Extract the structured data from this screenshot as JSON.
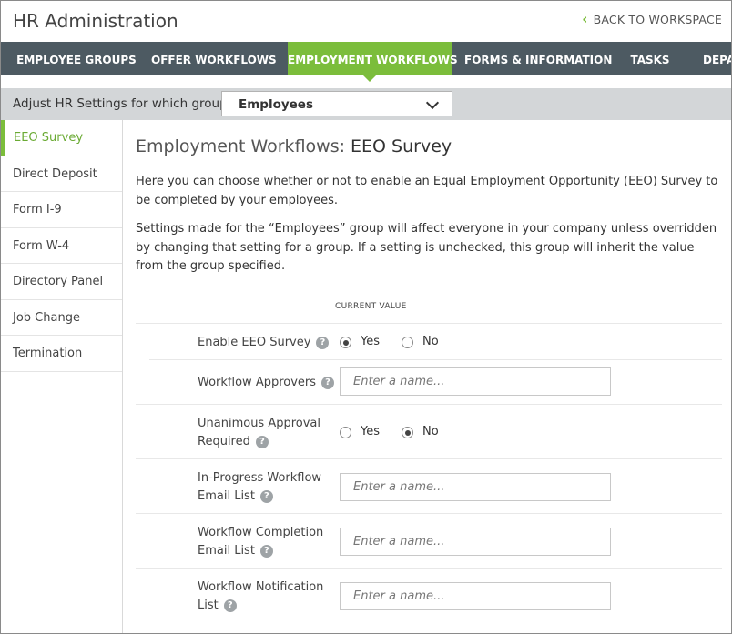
{
  "app": {
    "title": "HR Administration",
    "back_link": "BACK TO WORKSPACE"
  },
  "nav": {
    "tabs": [
      {
        "label": "EMPLOYEE GROUPS",
        "active": false
      },
      {
        "label": "OFFER WORKFLOWS",
        "active": false
      },
      {
        "label": "EMPLOYMENT WORKFLOWS",
        "active": true
      },
      {
        "label": "FORMS & INFORMATION",
        "active": false
      },
      {
        "label": "TASKS",
        "active": false
      },
      {
        "label": "DEPA",
        "active": false
      }
    ]
  },
  "group_bar": {
    "label": "Adjust HR Settings for which group?",
    "selected": "Employees"
  },
  "sidebar": {
    "items": [
      {
        "label": "EEO Survey",
        "active": true
      },
      {
        "label": "Direct Deposit",
        "active": false
      },
      {
        "label": "Form I-9",
        "active": false
      },
      {
        "label": "Form W-4",
        "active": false
      },
      {
        "label": "Directory Panel",
        "active": false
      },
      {
        "label": "Job Change",
        "active": false
      },
      {
        "label": "Termination",
        "active": false
      }
    ]
  },
  "main": {
    "title_prefix": "Employment Workflows: ",
    "title_strong": "EEO Survey",
    "para1": "Here you can choose whether or not to enable an Equal Employment Opportunity (EEO) Survey to be completed by your employees.",
    "para2": "Settings made for the “Employees” group will affect everyone in your company unless overridden by changing that setting for a group. If a setting is unchecked, this group will inherit the value from the group specified.",
    "current_value_header": "CURRENT VALUE"
  },
  "settings": {
    "enable_eeo": {
      "label": "Enable EEO Survey",
      "yes": "Yes",
      "no": "No",
      "value": "Yes"
    },
    "workflow_approvers": {
      "label": "Workflow Approvers",
      "placeholder": "Enter a name..."
    },
    "unanimous": {
      "label_line1": "Unanimous Approval",
      "label_line2": "Required",
      "yes": "Yes",
      "no": "No",
      "value": "No"
    },
    "in_progress": {
      "label_line1": "In-Progress Workflow",
      "label_line2": "Email List",
      "placeholder": "Enter a name..."
    },
    "completion": {
      "label_line1": "Workflow Completion",
      "label_line2": "Email List",
      "placeholder": "Enter a name..."
    },
    "notification": {
      "label_line1": "Workflow Notification",
      "label_line2": "List",
      "placeholder": "Enter a name..."
    }
  },
  "icons": {
    "help": "question-mark-icon",
    "back": "chevron-left-icon",
    "dropdown": "chevron-down-icon"
  },
  "colors": {
    "accent": "#7bbd3b",
    "nav_bg": "#4d5a62",
    "group_bar_bg": "#d3d6d8"
  }
}
